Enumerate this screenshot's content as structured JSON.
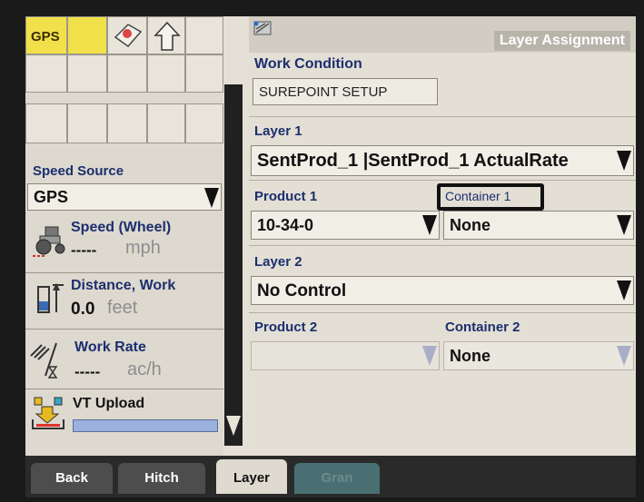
{
  "left_panel": {
    "top_cell_label": "GPS",
    "speed_source_label": "Speed Source",
    "speed_source_value": "GPS",
    "speed": {
      "label": "Speed (Wheel)",
      "value": "-----",
      "unit": "mph"
    },
    "distance": {
      "label": "Distance, Work",
      "value": "0.0",
      "unit": "feet"
    },
    "work_rate": {
      "label": "Work Rate",
      "value": "-----",
      "unit": "ac/h"
    },
    "vt_upload": {
      "label": "VT Upload"
    }
  },
  "main": {
    "title": "Layer Assignment",
    "work_condition": {
      "label": "Work Condition",
      "value": "SUREPOINT SETUP"
    },
    "layer1": {
      "label": "Layer 1",
      "value": "SentProd_1 |SentProd_1 ActualRate"
    },
    "product1": {
      "label": "Product 1",
      "value": "10-34-0"
    },
    "container1": {
      "label": "Container 1",
      "value": "None"
    },
    "layer2": {
      "label": "Layer 2",
      "value": "No Control"
    },
    "product2": {
      "label": "Product 2",
      "value": ""
    },
    "container2": {
      "label": "Container 2",
      "value": "None"
    }
  },
  "bottom_tabs": [
    {
      "label": "Back"
    },
    {
      "label": "Hitch"
    },
    {
      "label": "Layer"
    },
    {
      "label": "Gran"
    }
  ],
  "colors": {
    "label_blue": "#1c2f6e",
    "gps_yellow": "#f1e04a",
    "progress_blue": "#9ab0de"
  }
}
